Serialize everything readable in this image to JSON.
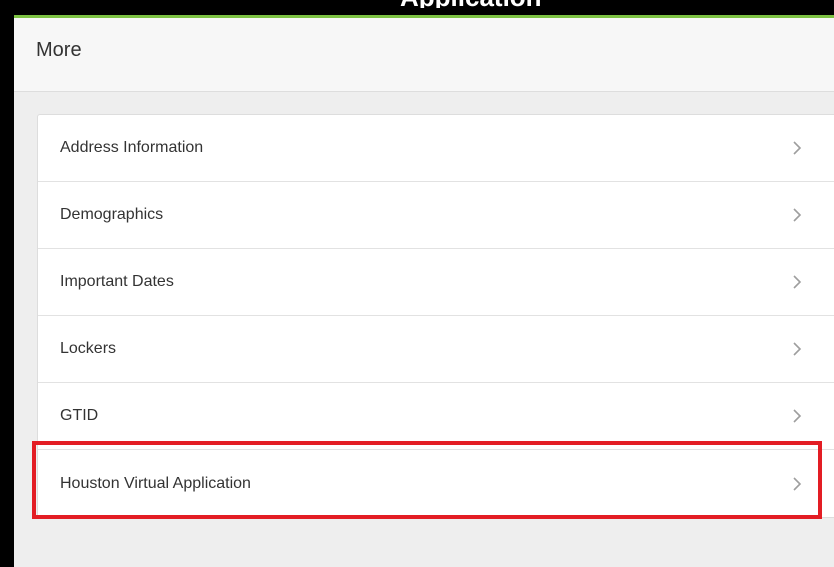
{
  "header": {
    "title": "More"
  },
  "title_fragment": "Application",
  "menu": {
    "items": [
      {
        "label": "Address Information",
        "icon": "chevron-right-icon"
      },
      {
        "label": "Demographics",
        "icon": "chevron-right-icon"
      },
      {
        "label": "Important Dates",
        "icon": "chevron-right-icon"
      },
      {
        "label": "Lockers",
        "icon": "chevron-right-icon"
      },
      {
        "label": "GTID",
        "icon": "chevron-right-icon"
      },
      {
        "label": "Houston Virtual Application",
        "icon": "chevron-right-icon"
      }
    ]
  },
  "colors": {
    "accent_top_bar": "#7dc243",
    "highlight": "#e31d24",
    "background": "#eeeeee",
    "card": "#ffffff",
    "chevron": "#9e9e9e"
  }
}
